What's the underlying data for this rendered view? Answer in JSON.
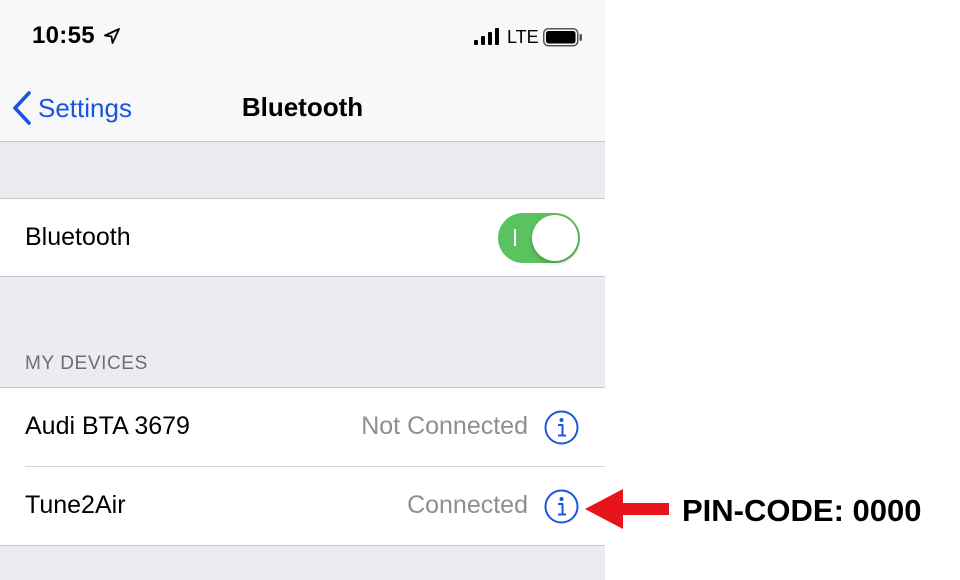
{
  "status_bar": {
    "time": "10:55",
    "network": "LTE",
    "location_icon": "location-arrow-icon",
    "signal_icon": "cellular-signal-icon",
    "battery_icon": "battery-icon"
  },
  "nav": {
    "back_label": "Settings",
    "back_icon": "chevron-left-icon",
    "title": "Bluetooth"
  },
  "bluetooth": {
    "label": "Bluetooth",
    "enabled": true,
    "toggle_color": "#5ac35f"
  },
  "devices_section": {
    "header": "MY DEVICES",
    "items": [
      {
        "name": "Audi BTA 3679",
        "status": "Not Connected",
        "info_icon": "info-icon"
      },
      {
        "name": "Tune2Air",
        "status": "Connected",
        "info_icon": "info-icon"
      }
    ]
  },
  "annotation": {
    "text": "PIN-CODE: 0000",
    "arrow_color": "#e8141b",
    "arrow_icon": "left-arrow-icon"
  },
  "colors": {
    "accent": "#1a55e0",
    "grouped_background": "#ebebf0",
    "secondary_text": "#8e8e93"
  }
}
